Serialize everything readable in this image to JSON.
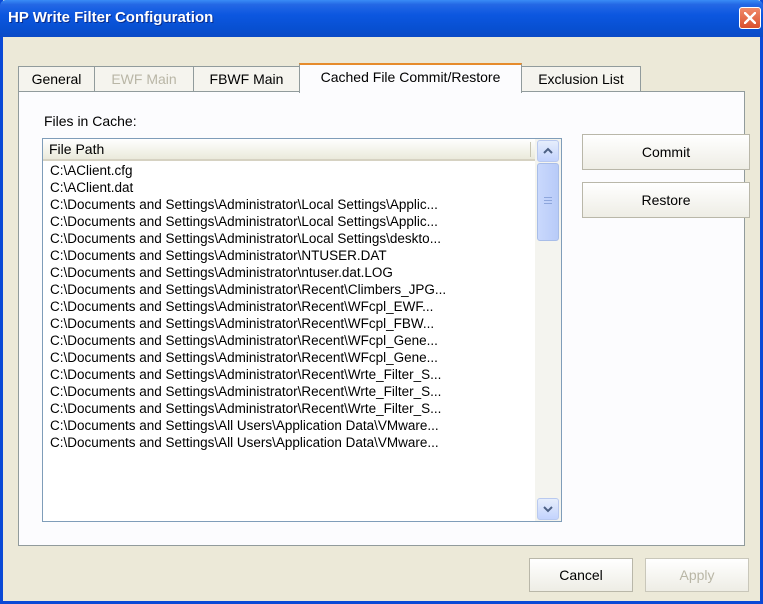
{
  "window": {
    "title": "HP Write Filter Configuration"
  },
  "tabs": [
    {
      "label": "General",
      "state": "normal"
    },
    {
      "label": "EWF Main",
      "state": "disabled"
    },
    {
      "label": "FBWF Main",
      "state": "normal"
    },
    {
      "label": "Cached File Commit/Restore",
      "state": "active"
    },
    {
      "label": "Exclusion List",
      "state": "normal"
    }
  ],
  "cache": {
    "section_label": "Files in Cache:",
    "column_header": "File Path",
    "files": [
      "C:\\AClient.cfg",
      "C:\\AClient.dat",
      "C:\\Documents and Settings\\Administrator\\Local Settings\\Applic...",
      "C:\\Documents and Settings\\Administrator\\Local Settings\\Applic...",
      "C:\\Documents and Settings\\Administrator\\Local Settings\\deskto...",
      "C:\\Documents and Settings\\Administrator\\NTUSER.DAT",
      "C:\\Documents and Settings\\Administrator\\ntuser.dat.LOG",
      "C:\\Documents and Settings\\Administrator\\Recent\\Climbers_JPG...",
      "C:\\Documents and Settings\\Administrator\\Recent\\WFcpl_EWF...",
      "C:\\Documents and Settings\\Administrator\\Recent\\WFcpl_FBW...",
      "C:\\Documents and Settings\\Administrator\\Recent\\WFcpl_Gene...",
      "C:\\Documents and Settings\\Administrator\\Recent\\WFcpl_Gene...",
      "C:\\Documents and Settings\\Administrator\\Recent\\Wrte_Filter_S...",
      "C:\\Documents and Settings\\Administrator\\Recent\\Wrte_Filter_S...",
      "C:\\Documents and Settings\\Administrator\\Recent\\Wrte_Filter_S...",
      "C:\\Documents and Settings\\All Users\\Application Data\\VMware...",
      "C:\\Documents and Settings\\All Users\\Application Data\\VMware..."
    ]
  },
  "actions": {
    "commit_label": "Commit",
    "restore_label": "Restore"
  },
  "footer": {
    "cancel_label": "Cancel",
    "apply_label": "Apply"
  },
  "colors": {
    "titlebar": "#0c57e0",
    "close": "#d9502d",
    "face": "#ece9d8",
    "tab_highlight": "#e68b2c"
  },
  "icons": {
    "close": "close-icon",
    "scroll_up": "scroll-up-arrow-icon",
    "scroll_down": "scroll-down-arrow-icon"
  }
}
